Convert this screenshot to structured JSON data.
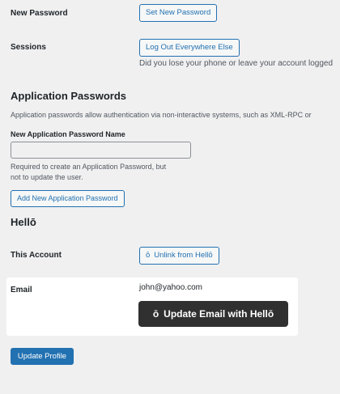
{
  "new_password": {
    "label": "New Password",
    "button": "Set New Password"
  },
  "sessions": {
    "label": "Sessions",
    "button": "Log Out Everywhere Else",
    "description": "Did you lose your phone or leave your account logged"
  },
  "app_passwords": {
    "heading": "Application Passwords",
    "description": "Application passwords allow authentication via non-interactive systems, such as XML-RPC or",
    "name_label": "New Application Password Name",
    "name_value": "",
    "help_line1": "Required to create an Application Password, but",
    "help_line2": "not to update the user.",
    "add_button": "Add New Application Password"
  },
  "hello": {
    "heading": "Hellō",
    "account_label": "This Account",
    "unlink_glyph": "ō",
    "unlink_button": "Unlink from Hellō",
    "email_label": "Email",
    "email_value": "john@yahoo.com",
    "update_glyph": "ō",
    "update_button": "Update Email with Hellō"
  },
  "footer": {
    "update_profile": "Update Profile"
  },
  "colors": {
    "background": "#f0f0f1",
    "accent": "#2271b1",
    "hello_button": "#303030"
  }
}
